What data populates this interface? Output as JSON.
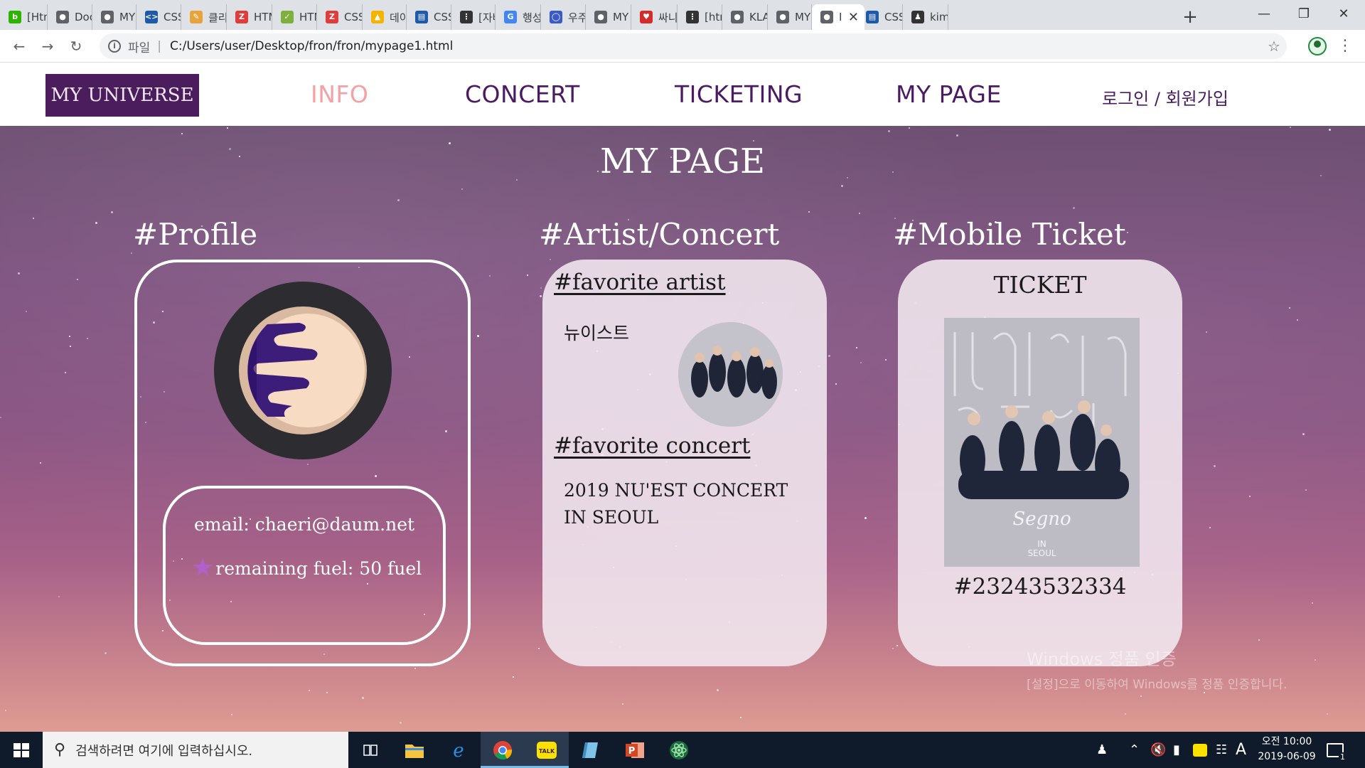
{
  "browser": {
    "tabs": [
      {
        "label": "[Htm",
        "icon": "blog-icon",
        "color": "#2db400"
      },
      {
        "label": "Doc",
        "icon": "globe-icon",
        "color": "#5f6368"
      },
      {
        "label": "MY",
        "icon": "globe-icon",
        "color": "#5f6368"
      },
      {
        "label": "CSS",
        "icon": "code-icon",
        "color": "#1e5aa8"
      },
      {
        "label": "클리",
        "icon": "note-icon",
        "color": "#e8a33b"
      },
      {
        "label": "HTM",
        "icon": "z-icon",
        "color": "#e23b3b"
      },
      {
        "label": "HTM",
        "icon": "check-icon",
        "color": "#7fb03b"
      },
      {
        "label": "CSS",
        "icon": "z-icon",
        "color": "#e23b3b"
      },
      {
        "label": "데이",
        "icon": "drive-icon",
        "color": "#f4b400"
      },
      {
        "label": "CSS",
        "icon": "chart-icon",
        "color": "#1e5aa8"
      },
      {
        "label": "[자바",
        "icon": "dots-icon",
        "color": "#333333"
      },
      {
        "label": "행성",
        "icon": "google-icon",
        "color": "#4285f4"
      },
      {
        "label": "우주",
        "icon": "circle-icon",
        "color": "#3b5ac9"
      },
      {
        "label": "MY",
        "icon": "globe-icon",
        "color": "#5f6368"
      },
      {
        "label": "싸니",
        "icon": "heart-icon",
        "color": "#d62b2b"
      },
      {
        "label": "[htm",
        "icon": "dots-icon",
        "color": "#333333"
      },
      {
        "label": "KLA",
        "icon": "globe-icon",
        "color": "#5f6368"
      },
      {
        "label": "MY",
        "icon": "globe-icon",
        "color": "#5f6368"
      },
      {
        "label": "I",
        "icon": "globe-icon",
        "color": "#5f6368",
        "active": true
      },
      {
        "label": "CSS",
        "icon": "chart-icon",
        "color": "#1e5aa8"
      },
      {
        "label": "kimc",
        "icon": "person-icon",
        "color": "#333333"
      }
    ],
    "address": {
      "scheme": "파일",
      "url": "C:/Users/user/Desktop/fron/fron/mypage1.html"
    }
  },
  "site": {
    "logo": "MY UNIVERSE",
    "nav": [
      "INFO",
      "CONCERT",
      "TICKETING",
      "MY PAGE"
    ],
    "login": "로그인 / 회원가입",
    "page_title": "MY PAGE",
    "profile": {
      "heading": "#Profile",
      "email": "email: chaeri@daum.net",
      "fuel": "remaining fuel: 50 fuel"
    },
    "artist": {
      "heading": "#Artist/Concert",
      "favorite_artist_label": "#favorite artist",
      "artist_name": "뉴이스트",
      "favorite_concert_label": "#favorite concert",
      "concert_name": "2019 NU'EST CONCERT IN SEOUL"
    },
    "ticket": {
      "heading": "#Mobile Ticket",
      "title": "TICKET",
      "number": "#23243532334",
      "poster_text": "Segno",
      "poster_sub": "IN\nSEOUL"
    },
    "watermark": {
      "title": "Windows 정품 인증",
      "subtitle": "[설정]으로 이동하여 Windows를 정품 인증합니다."
    }
  },
  "taskbar": {
    "search_placeholder": "검색하려면 여기에 입력하십시오.",
    "time": "오전 10:00",
    "date": "2019-06-09",
    "notifications": "1"
  }
}
